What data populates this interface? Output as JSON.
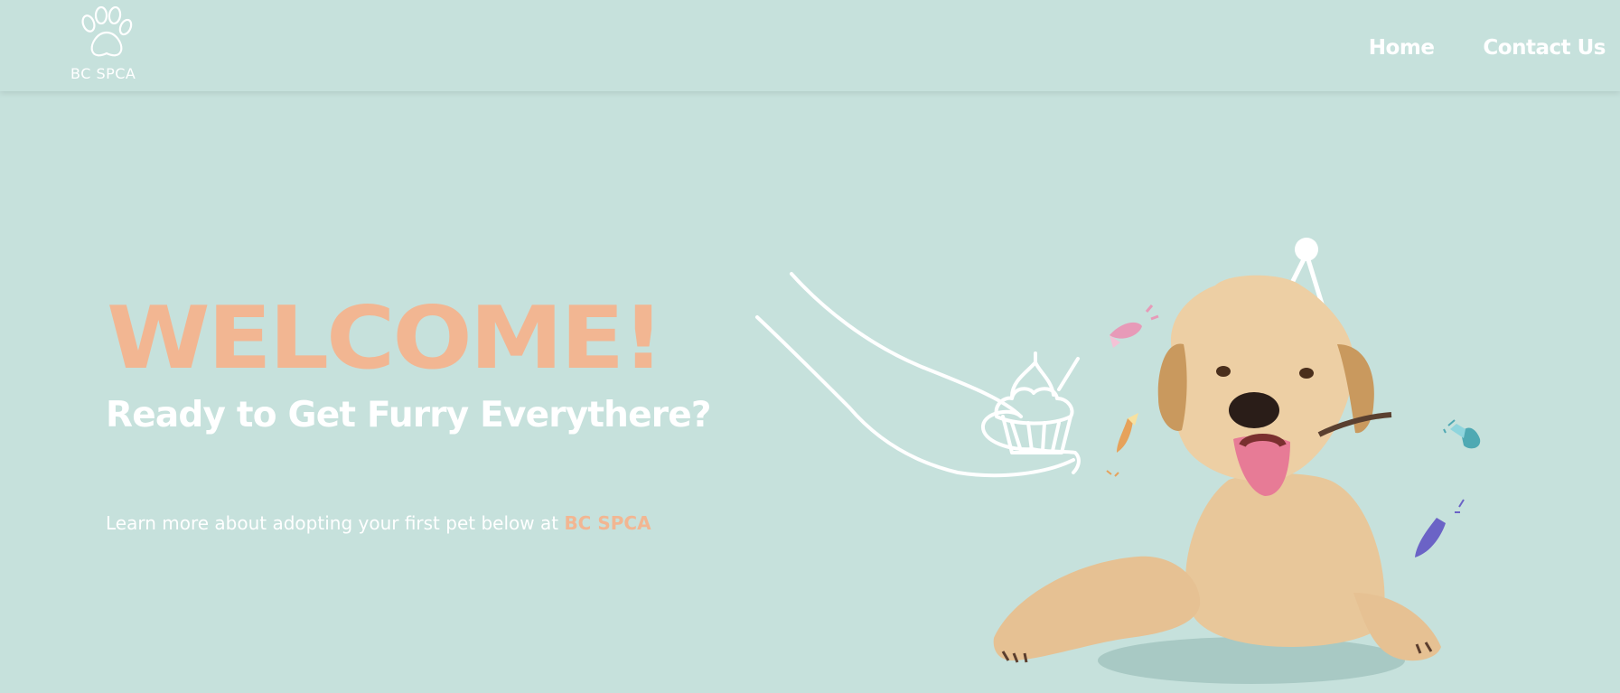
{
  "header": {
    "logo_text": "BC SPCA",
    "logo_icon": "paw-icon",
    "nav": [
      {
        "label": "Home"
      },
      {
        "label": "Contact Us"
      }
    ]
  },
  "hero": {
    "title": "WELCOME!",
    "subtitle": "Ready to Get Furry Everythere?",
    "learn_text": "Learn more about adopting your first pet below at",
    "learn_link": "BC SPCA",
    "illustration": "hand-cupcake-dog-party-icon"
  },
  "colors": {
    "background": "#c6e1dc",
    "accent": "#f2b692",
    "text": "#ffffff"
  }
}
